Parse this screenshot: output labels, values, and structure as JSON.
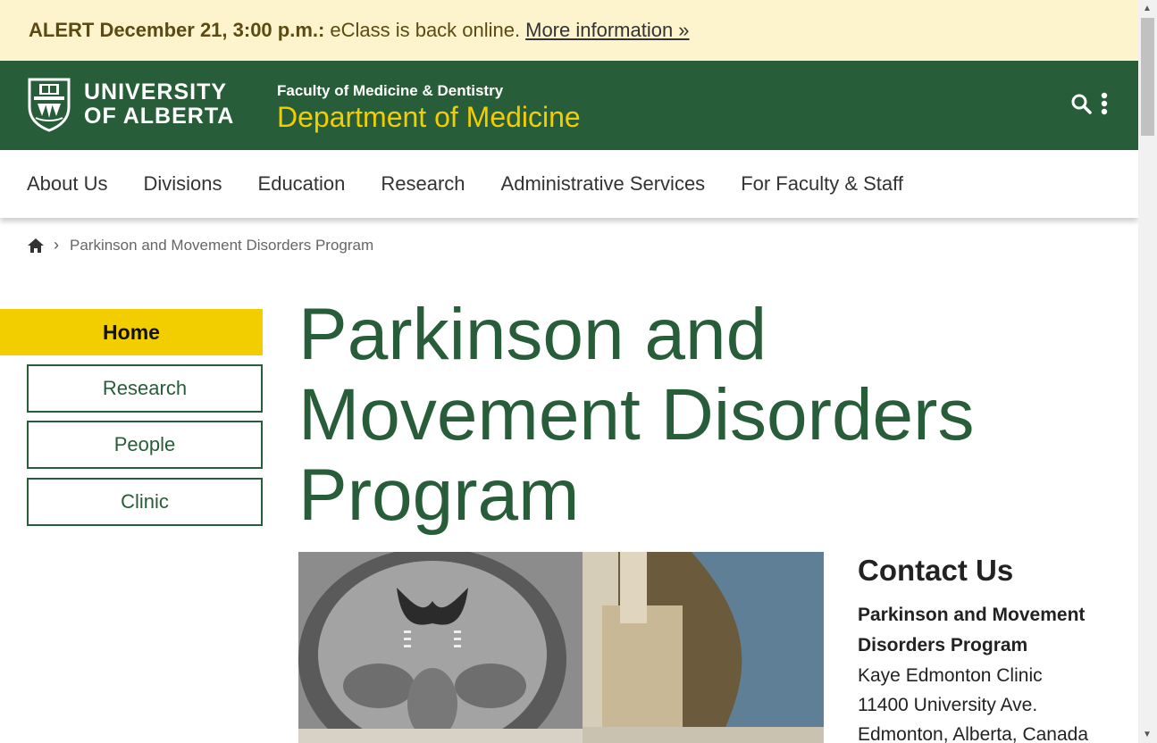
{
  "alert": {
    "label": "ALERT December 21, 3:00 p.m.:",
    "message": "eClass is back online.",
    "link": "More information »"
  },
  "header": {
    "logo_line1": "UNIVERSITY",
    "logo_line2": "OF ALBERTA",
    "faculty": "Faculty of Medicine & Dentistry",
    "department": "Department of Medicine",
    "search_icon": "search-icon",
    "more_icon": "vertical-dots-icon"
  },
  "nav": {
    "items": [
      "About Us",
      "Divisions",
      "Education",
      "Research",
      "Administrative Services",
      "For Faculty & Staff"
    ]
  },
  "breadcrumb": {
    "home_icon": "home-icon",
    "current": "Parkinson and Movement Disorders Program"
  },
  "sidebar": {
    "home": "Home",
    "items": [
      "Research",
      "People",
      "Clinic"
    ]
  },
  "main": {
    "title": "Parkinson and Movement Disorders Program"
  },
  "contact": {
    "heading": "Contact Us",
    "program": "Parkinson and Movement Disorders Program",
    "line1": "Kaye Edmonton Clinic",
    "line2": "11400 University Ave.",
    "line3": "Edmonton, Alberta, Canada"
  },
  "colors": {
    "green": "#275d38",
    "gold": "#f2cd00",
    "alert_bg": "#fdf3cd"
  }
}
